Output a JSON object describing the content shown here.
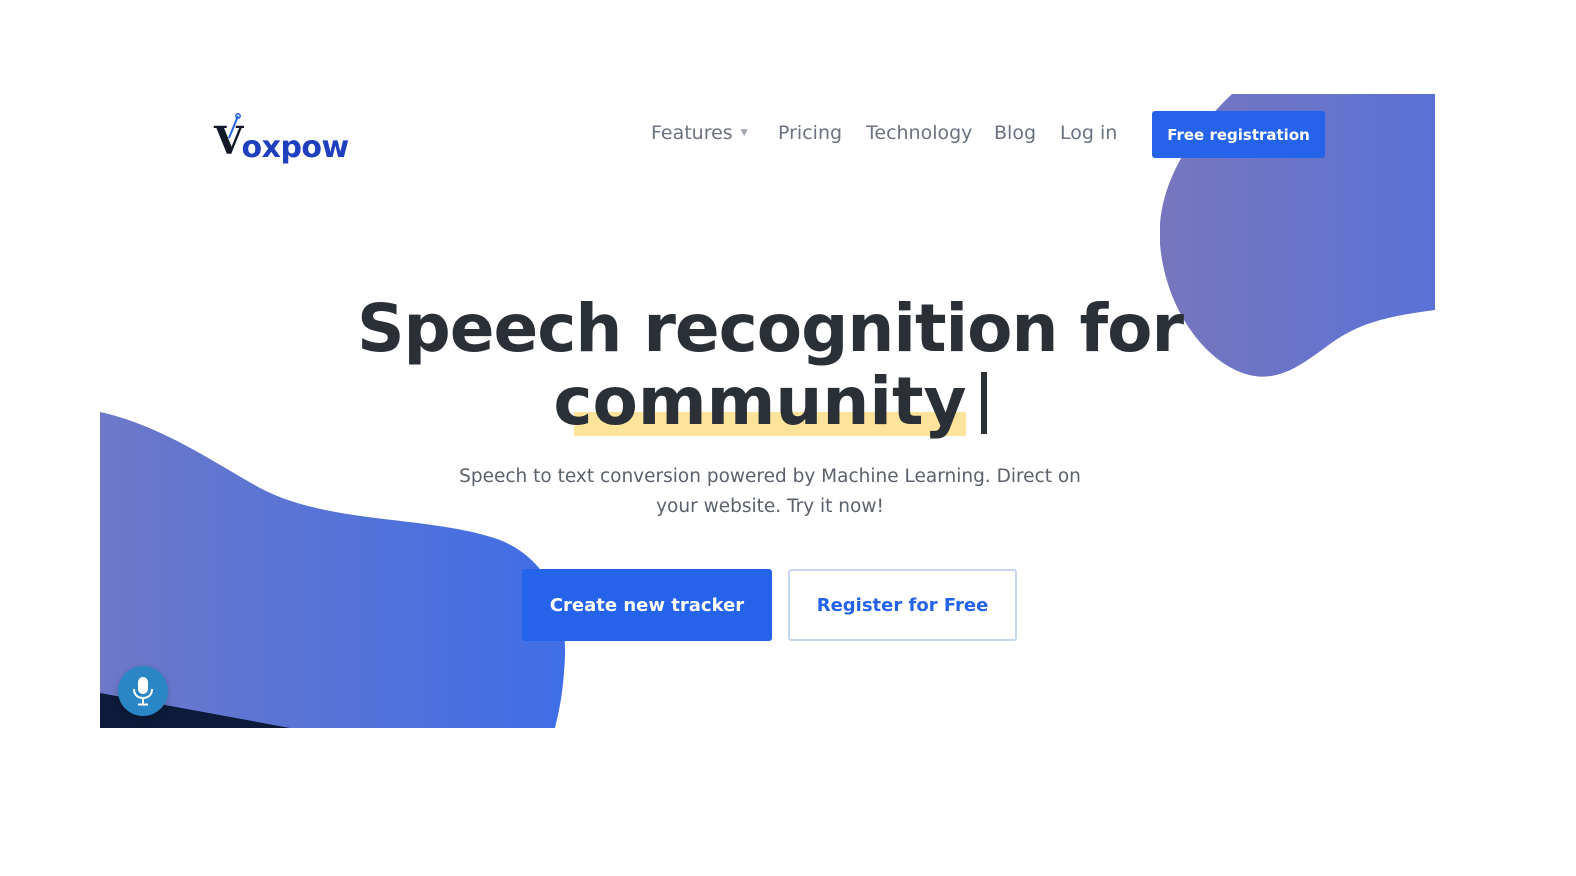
{
  "brand": {
    "logo_first": "V",
    "logo_rest": "oxpow"
  },
  "nav": {
    "items": [
      {
        "label": "Features",
        "has_dropdown": true
      },
      {
        "label": "Pricing"
      },
      {
        "label": "Technology"
      },
      {
        "label": "Blog"
      },
      {
        "label": "Log in"
      }
    ],
    "cta_label": "Free registration"
  },
  "hero": {
    "headline_line1": "Speech recognition for",
    "headline_line2": "community",
    "subtitle": "Speech to text conversion powered by Machine Learning. Direct on your website. Try it now!",
    "primary_button": "Create new tracker",
    "secondary_button": "Register for Free"
  },
  "widgets": {
    "mic_icon": "microphone-icon"
  },
  "colors": {
    "accent": "#2563eb",
    "blob_start": "#7676bd",
    "blob_end": "#3f6ee6",
    "highlight": "#fde49a",
    "mic": "#2b86c5"
  }
}
